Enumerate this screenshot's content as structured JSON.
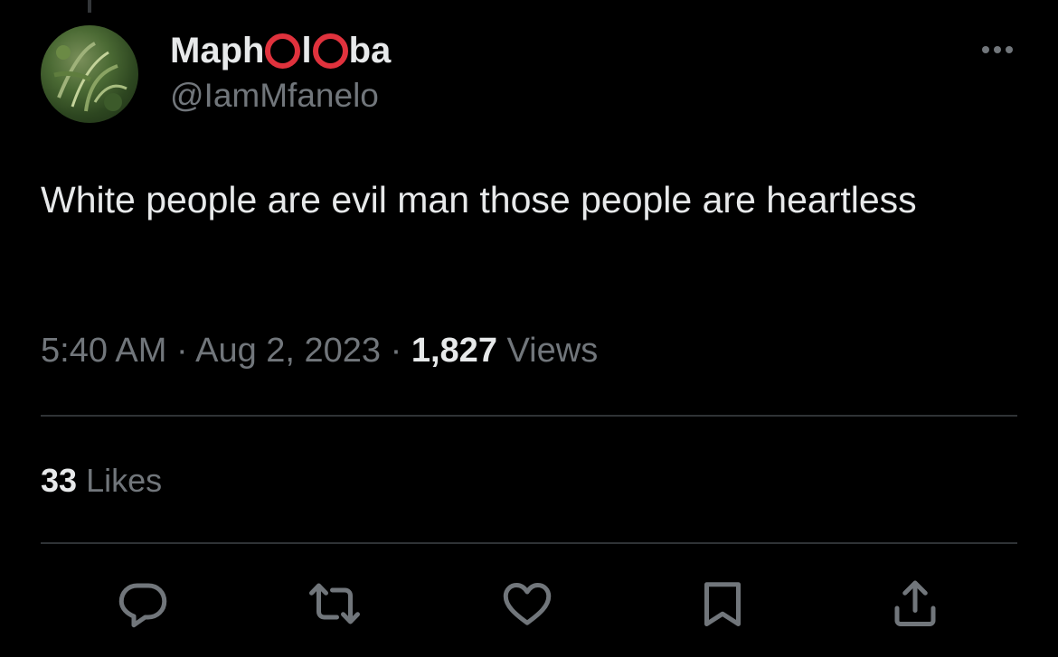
{
  "author": {
    "display_name_parts": [
      "Maph",
      "l",
      "ba"
    ],
    "handle": "@IamMfanelo",
    "avatar_icon": "avatar-image",
    "name_ring_color": "#e0323d"
  },
  "tweet": {
    "text": "White people are evil man those people are heartless",
    "time": "5:40 AM",
    "separator": "·",
    "date": "Aug 2, 2023",
    "views_count": "1,827",
    "views_label": "Views"
  },
  "engagement": {
    "likes_count": "33",
    "likes_label": "Likes"
  },
  "actions": [
    {
      "name": "reply",
      "icon": "reply-icon"
    },
    {
      "name": "repost",
      "icon": "repost-icon"
    },
    {
      "name": "like",
      "icon": "heart-icon"
    },
    {
      "name": "bookmark",
      "icon": "bookmark-icon"
    },
    {
      "name": "share",
      "icon": "share-icon"
    }
  ],
  "colors": {
    "background": "#000000",
    "primary_text": "#e7e9ea",
    "secondary_text": "#71767b",
    "divider": "#2f3336"
  }
}
